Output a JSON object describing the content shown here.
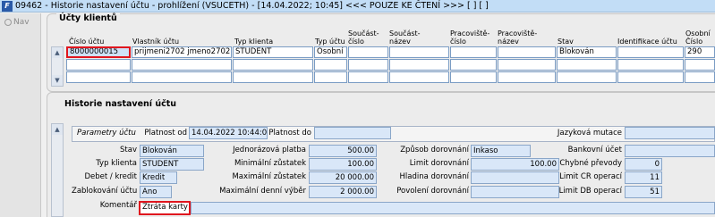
{
  "window": {
    "title": "09462 - Historie nastavení účtu - prohlížení (VSUCETH) - [14.04.2022; 10:45] <<< POUZE KE ČTENÍ >>> [ ] [ ]",
    "app_icon": "app-icon"
  },
  "nav": {
    "label": "Nav"
  },
  "accounts": {
    "section_title": "Účty klientů",
    "columns": [
      "Číslo účtu",
      "Vlastník účtu",
      "Typ klienta",
      "Typ účtu",
      "Součást-\nčíslo",
      "Součást-\nnázev",
      "Pracoviště-\nčíslo",
      "Pracoviště-\nnázev",
      "Stav",
      "Identifikace účtu",
      "Osobní\nČíslo"
    ],
    "row": {
      "cislo_uctu": "8000000015",
      "vlastnik": "prijmeni2702 jmeno2702",
      "typ_klienta": "STUDENT",
      "typ_uctu": "Osobní",
      "soucast_cislo": "",
      "soucast_nazev": "",
      "prac_cislo": "",
      "prac_nazev": "",
      "stav": "Blokován",
      "identifikace": "",
      "osobni_cislo": "290"
    }
  },
  "history": {
    "section_title": "Historie nastavení účtu",
    "params_label": "Parametry účtu",
    "platnost_od_label": "Platnost od",
    "platnost_od": "14.04.2022 10:44:00",
    "platnost_do_label": "Platnost do",
    "platnost_do": "",
    "jazykova_mutace_label": "Jazyková mutace",
    "jazykova_mutace": "",
    "stav_label": "Stav",
    "stav": "Blokován",
    "typ_klienta_label": "Typ klienta",
    "typ_klienta": "STUDENT",
    "debet_label": "Debet / kredit",
    "debet": "Kredit",
    "zablokovani_label": "Zablokování účtu",
    "zablokovani": "Ano",
    "komentar_label": "Komentář",
    "komentar": "Ztráta karty",
    "jednorazova_label": "Jednorázová platba",
    "jednorazova": "500.00",
    "min_zustatek_label": "Minimální zůstatek",
    "min_zustatek": "100.00",
    "max_zustatek_label": "Maximální zůstatek",
    "max_zustatek": "20 000.00",
    "max_vyber_label": "Maximální denní výběr",
    "max_vyber": "2 000.00",
    "zpusob_label": "Způsob dorovnání",
    "zpusob": "Inkaso",
    "limit_dor_label": "Limit dorovnání",
    "limit_dor": "100.00",
    "hladina_label": "Hladina dorovnání",
    "hladina": "",
    "povoleni_label": "Povolení dorovnání",
    "povoleni": "",
    "bankovni_label": "Bankovní účet",
    "bankovni": "",
    "chybne_label": "Chybné převody",
    "chybne": "0",
    "limit_cr_label": "Limit CR operací",
    "limit_cr": "11",
    "limit_db_label": "Limit DB operací",
    "limit_db": "51"
  }
}
